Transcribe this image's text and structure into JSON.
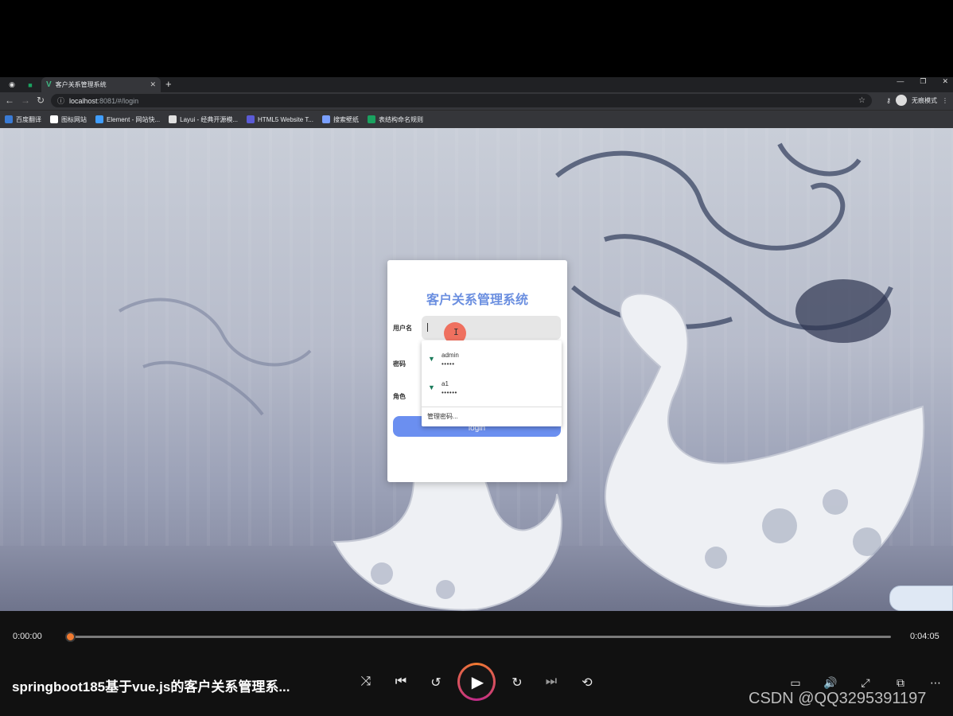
{
  "browser": {
    "tab_title": "客户关系管理系统",
    "url_host": "localhost",
    "url_path": ":8081/#/login",
    "profile_label": "无痕模式",
    "bookmarks": [
      {
        "label": "百度翻译",
        "color": "#3a7bd5"
      },
      {
        "label": "图标网站",
        "color": "#ffffff"
      },
      {
        "label": "Element - 网站快...",
        "color": "#409eff"
      },
      {
        "label": "Layui - 经典开源模...",
        "color": "#e0e0e0"
      },
      {
        "label": "HTML5 Website T...",
        "color": "#5b5bd6"
      },
      {
        "label": "搜索壁纸",
        "color": "#7aa0ff"
      },
      {
        "label": "表结构命名规则",
        "color": "#1aa260"
      }
    ]
  },
  "login": {
    "title": "客户关系管理系统",
    "username_label": "用户名",
    "password_label": "密码",
    "role_label": "角色",
    "button_label": "login"
  },
  "autofill": {
    "entries": [
      {
        "username": "admin",
        "password": "•••••"
      },
      {
        "username": "a1",
        "password": "••••••"
      }
    ],
    "manage_label": "管理密码..."
  },
  "player": {
    "current_time": "0:00:00",
    "total_time": "0:04:05",
    "progress": 0,
    "title": "springboot185基于vue.js的客户关系管理系...",
    "watermark": "CSDN @QQ3295391197",
    "accent_color": "#f07a30",
    "icons": [
      "shuffle-icon",
      "previous-icon",
      "rewind-10-icon",
      "play-icon",
      "forward-30-icon",
      "next-icon",
      "repeat-off-icon",
      "subtitles-icon",
      "volume-icon",
      "fullscreen-icon",
      "miniplayer-icon",
      "more-icon"
    ]
  }
}
